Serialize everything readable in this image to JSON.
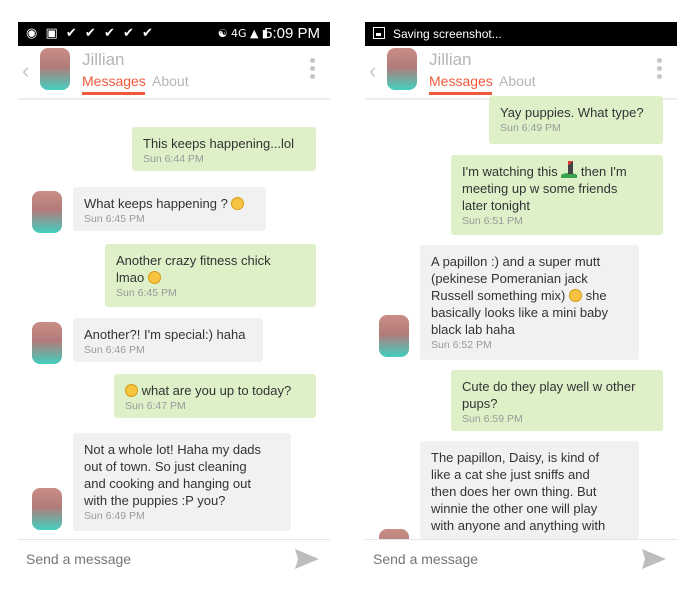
{
  "left": {
    "status": {
      "time": "5:09 PM",
      "network": "4G"
    },
    "header": {
      "name": "Jillian",
      "tab_messages": "Messages",
      "tab_about": "About"
    },
    "messages": [
      {
        "text": "This keeps happening...lol",
        "time": "Sun 6:44 PM"
      },
      {
        "text": "What keeps happening ? ",
        "time": "Sun 6:45 PM"
      },
      {
        "text_a": "Another crazy fitness chick",
        "text_b": "lmao ",
        "time": "Sun 6:45 PM"
      },
      {
        "text": "Another?! I'm special:) haha",
        "time": "Sun 6:46 PM"
      },
      {
        "text": " what are you up to today?",
        "time": "Sun 6:47 PM"
      },
      {
        "lines": [
          "Not a whole lot! Haha my dads",
          "out of town. So just cleaning",
          "and cooking and hanging out",
          "with the puppies :P you?"
        ],
        "time": "Sun 6:49 PM"
      }
    ],
    "composer": {
      "placeholder": "Send a message"
    }
  },
  "right": {
    "status": {
      "saving": "Saving screenshot..."
    },
    "header": {
      "name": "Jillian",
      "tab_messages": "Messages",
      "tab_about": "About"
    },
    "messages": [
      {
        "text": "Yay puppies. What type?",
        "time": "Sun 6:49 PM"
      },
      {
        "line1_a": "I'm watching this ",
        "line1_b": " then I'm",
        "line2": "meeting up w some friends",
        "line3": "later tonight",
        "time": "Sun 6:51 PM"
      },
      {
        "line1": "A papillon :) and a super mutt",
        "line2": "(pekinese Pomeranian jack",
        "line3_a": "Russell something mix) ",
        "line3_b": " she",
        "line4": "basically looks like a mini baby",
        "line5": "black lab haha",
        "time": "Sun 6:52 PM"
      },
      {
        "lines": [
          "Cute do they play well w other",
          "pups?"
        ],
        "time": "Sun 6:59 PM"
      },
      {
        "lines": [
          "The papillon, Daisy, is kind of",
          "like a cat she just sniffs and",
          "then does her own thing. But",
          "winnie the other one will play",
          "with anyone and anything with"
        ]
      }
    ],
    "composer": {
      "placeholder": "Send a message"
    }
  }
}
